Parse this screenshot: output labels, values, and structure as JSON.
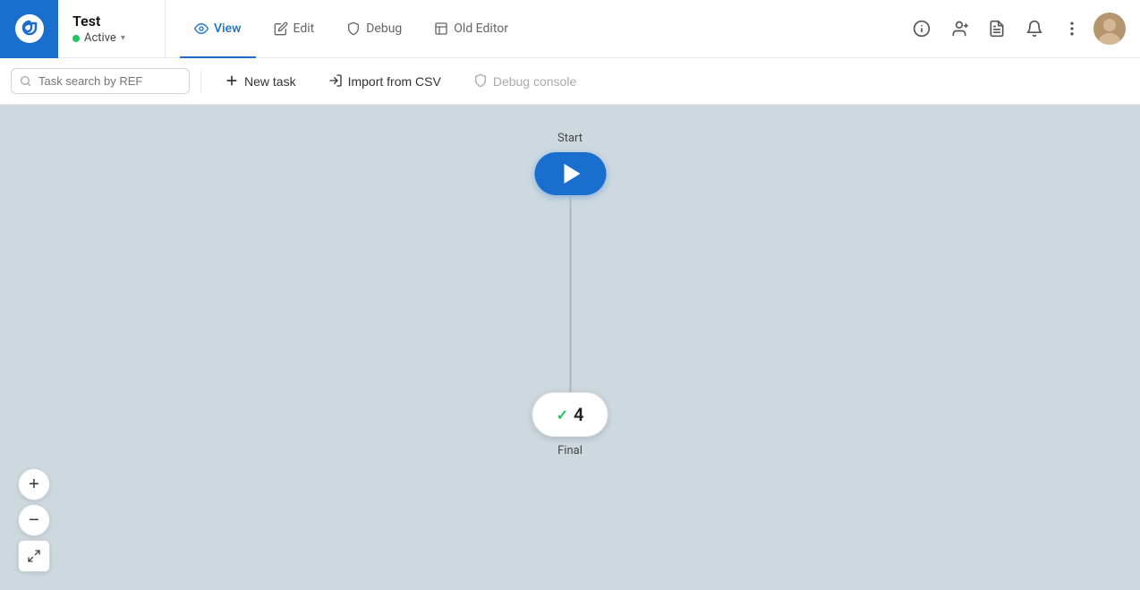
{
  "app": {
    "title": "Test",
    "status": "Active",
    "logo_letter": "●"
  },
  "nav": {
    "tabs": [
      {
        "id": "view",
        "label": "View",
        "active": true
      },
      {
        "id": "edit",
        "label": "Edit",
        "active": false
      },
      {
        "id": "debug",
        "label": "Debug",
        "active": false
      },
      {
        "id": "old-editor",
        "label": "Old Editor",
        "active": false
      }
    ]
  },
  "toolbar": {
    "search_placeholder": "Task search by REF",
    "new_task_label": "New task",
    "import_label": "Import from CSV",
    "debug_console_label": "Debug console"
  },
  "flow": {
    "start_label": "Start",
    "final_label": "Final",
    "final_count": "4"
  },
  "zoom": {
    "plus_label": "+",
    "minus_label": "−",
    "fit_label": "⤢"
  },
  "header_icons": {
    "info": "ℹ",
    "add_user": "👤+",
    "notes": "📋",
    "bell": "🔔",
    "more": "⋮"
  }
}
